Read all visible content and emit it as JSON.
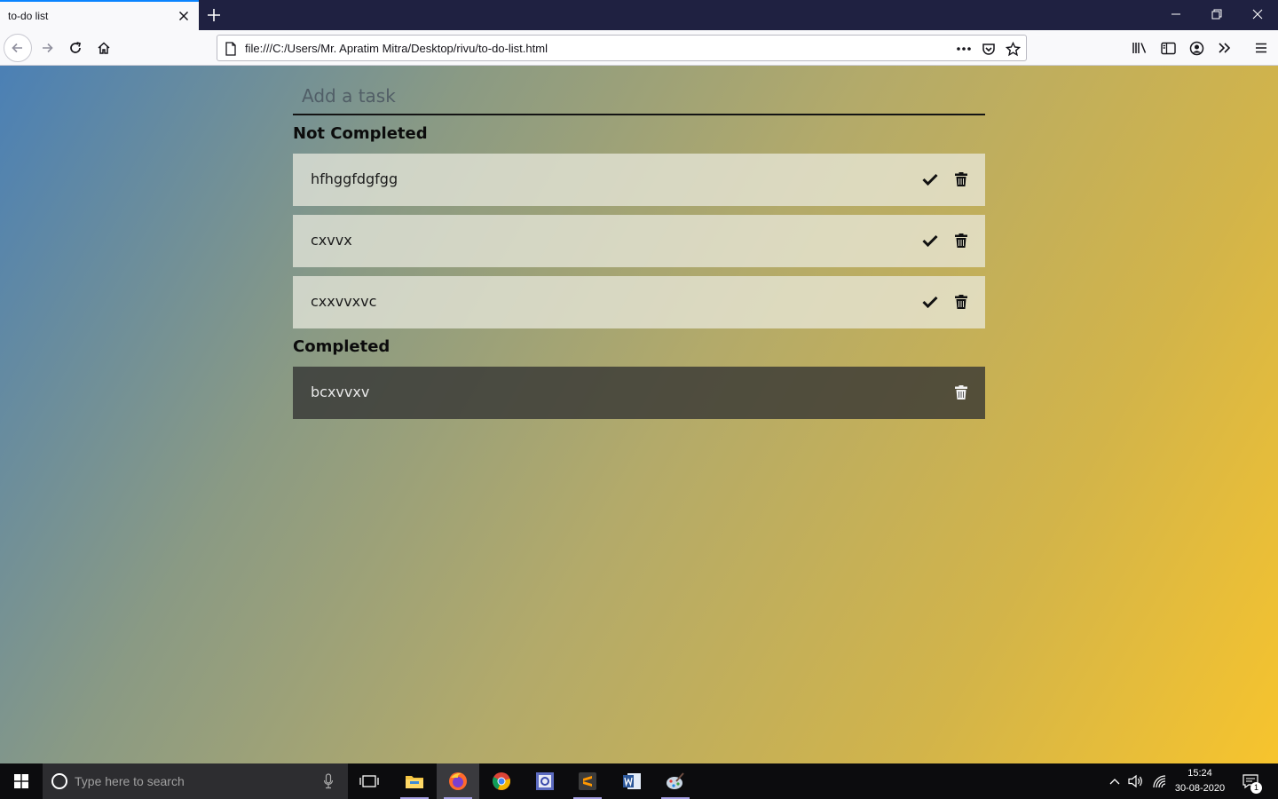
{
  "browser": {
    "tab_title": "to-do list",
    "url": "file:///C:/Users/Mr. Apratim Mitra/Desktop/rivu/to-do-list.html"
  },
  "todo": {
    "input_placeholder": "Add a task",
    "not_completed_title": "Not Completed",
    "completed_title": "Completed",
    "not_completed": [
      "hfhggfdgfgg",
      "cxvvx",
      "cxxvvxvc"
    ],
    "completed": [
      "bcxvvxv"
    ]
  },
  "taskbar": {
    "search_placeholder": "Type here to search",
    "time": "15:24",
    "date": "30-08-2020",
    "notification_count": "1"
  },
  "colors": {
    "gradient_start": "#4b80b5",
    "gradient_end": "#f7c42d",
    "tab_strip": "#1f2141",
    "accent": "#0a84ff"
  }
}
